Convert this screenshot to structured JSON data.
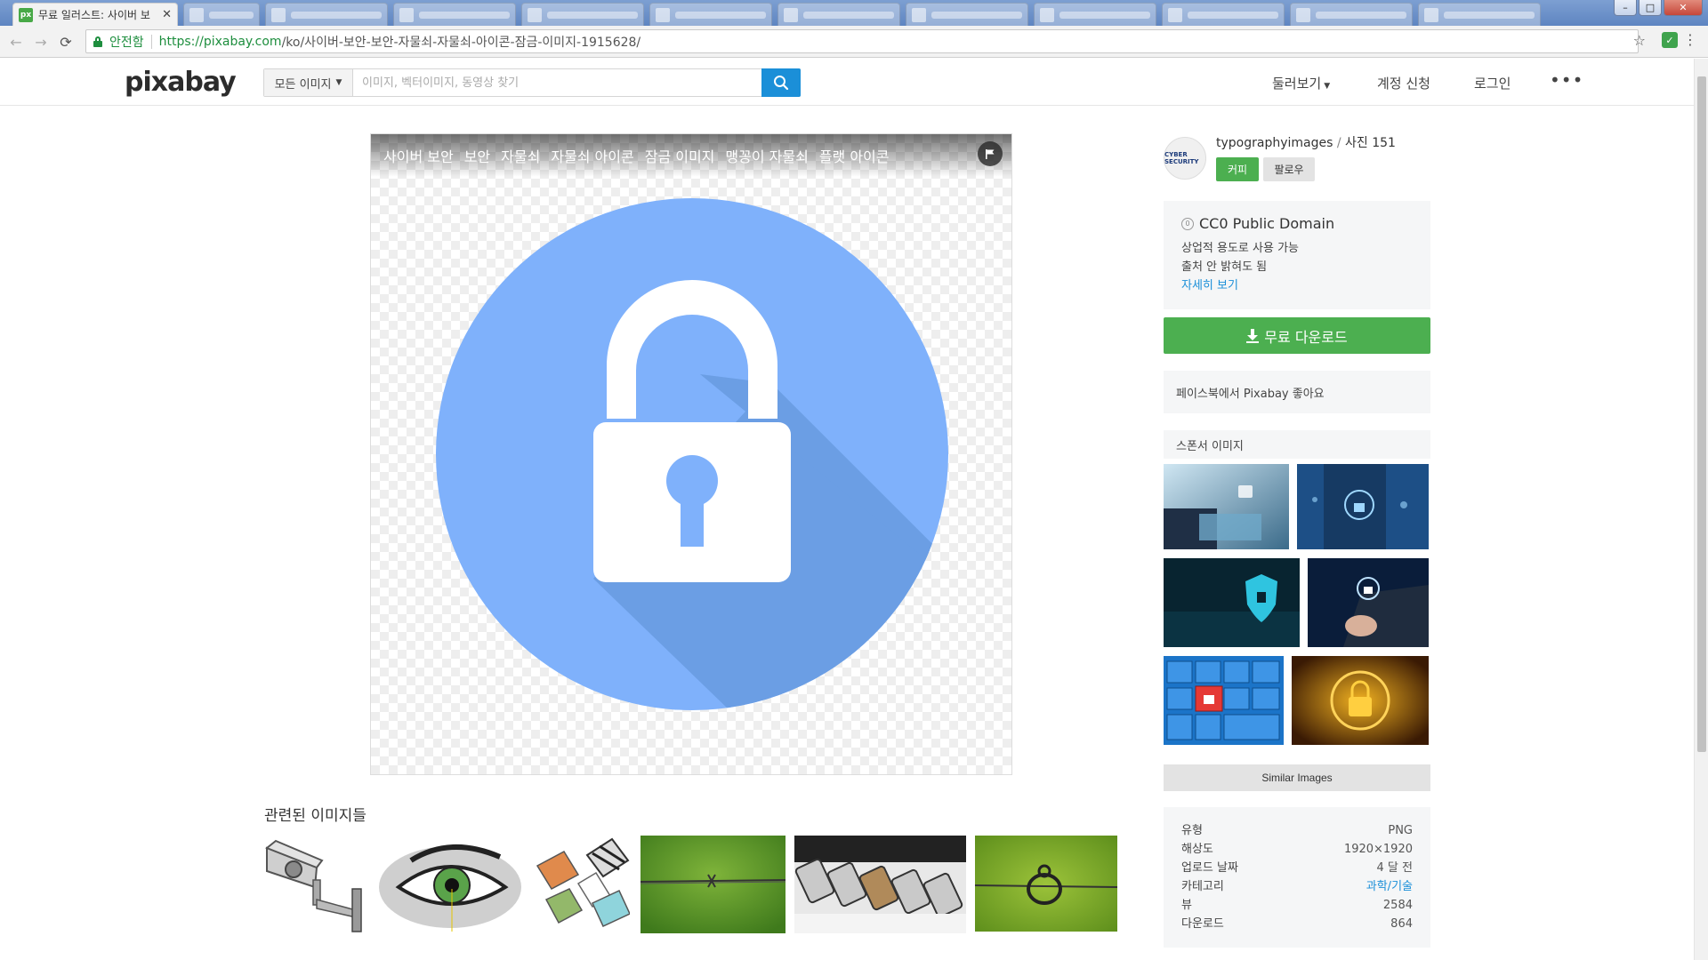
{
  "browser": {
    "active_tab_title": "무료 일러스트: 사이버 보",
    "tab_close": "✕",
    "favicon_text": "px",
    "secure_label": "안전함",
    "url_host": "https://pixabay.com",
    "url_path": "/ko/사이버-보안-보안-자물쇠-자물쇠-아이콘-잠금-이미지-1915628/"
  },
  "header": {
    "logo": "pixabay",
    "search_scope": "모든 이미지",
    "search_placeholder": "이미지, 벡터이미지, 동영상 찾기",
    "nav_explore": "둘러보기",
    "nav_signup": "계정 신청",
    "nav_login": "로그인",
    "more": "•••"
  },
  "image": {
    "tags": [
      "사이버 보안",
      "보안",
      "자물쇠",
      "자물쇠 아이콘",
      "잠금 이미지",
      "맹꽁이 자물쇠",
      "플랫 아이콘"
    ],
    "circle_color": "#7fb1fb",
    "shadow_color": "#6b9ee4",
    "lock_color": "#ffffff"
  },
  "related": {
    "title": "관련된 이미지들"
  },
  "author": {
    "avatar_text": "CYBER SECURITY",
    "name": "typographyimages",
    "separator": " / ",
    "count_label": "사진 151",
    "coffee_label": "커피",
    "follow_label": "팔로우"
  },
  "license": {
    "icon": "0",
    "title": "CC0 Public Domain",
    "line1": "상업적 용도로 사용 가능",
    "line2": "출처 안 밝혀도 됨",
    "link": "자세히 보기"
  },
  "download": {
    "label": "무료 다운로드"
  },
  "facebook": {
    "label": "페이스북에서 Pixabay 좋아요"
  },
  "sponsor": {
    "label": "스폰서 이미지"
  },
  "similar": {
    "label": "Similar Images"
  },
  "info": {
    "rows": [
      {
        "k": "유형",
        "v": "PNG"
      },
      {
        "k": "해상도",
        "v": "1920×1920"
      },
      {
        "k": "업로드 날짜",
        "v": "4 달 전"
      },
      {
        "k": "카테고리",
        "v": "과학/기술"
      },
      {
        "k": "뷰",
        "v": "2584"
      },
      {
        "k": "다운로드",
        "v": "864"
      }
    ]
  }
}
